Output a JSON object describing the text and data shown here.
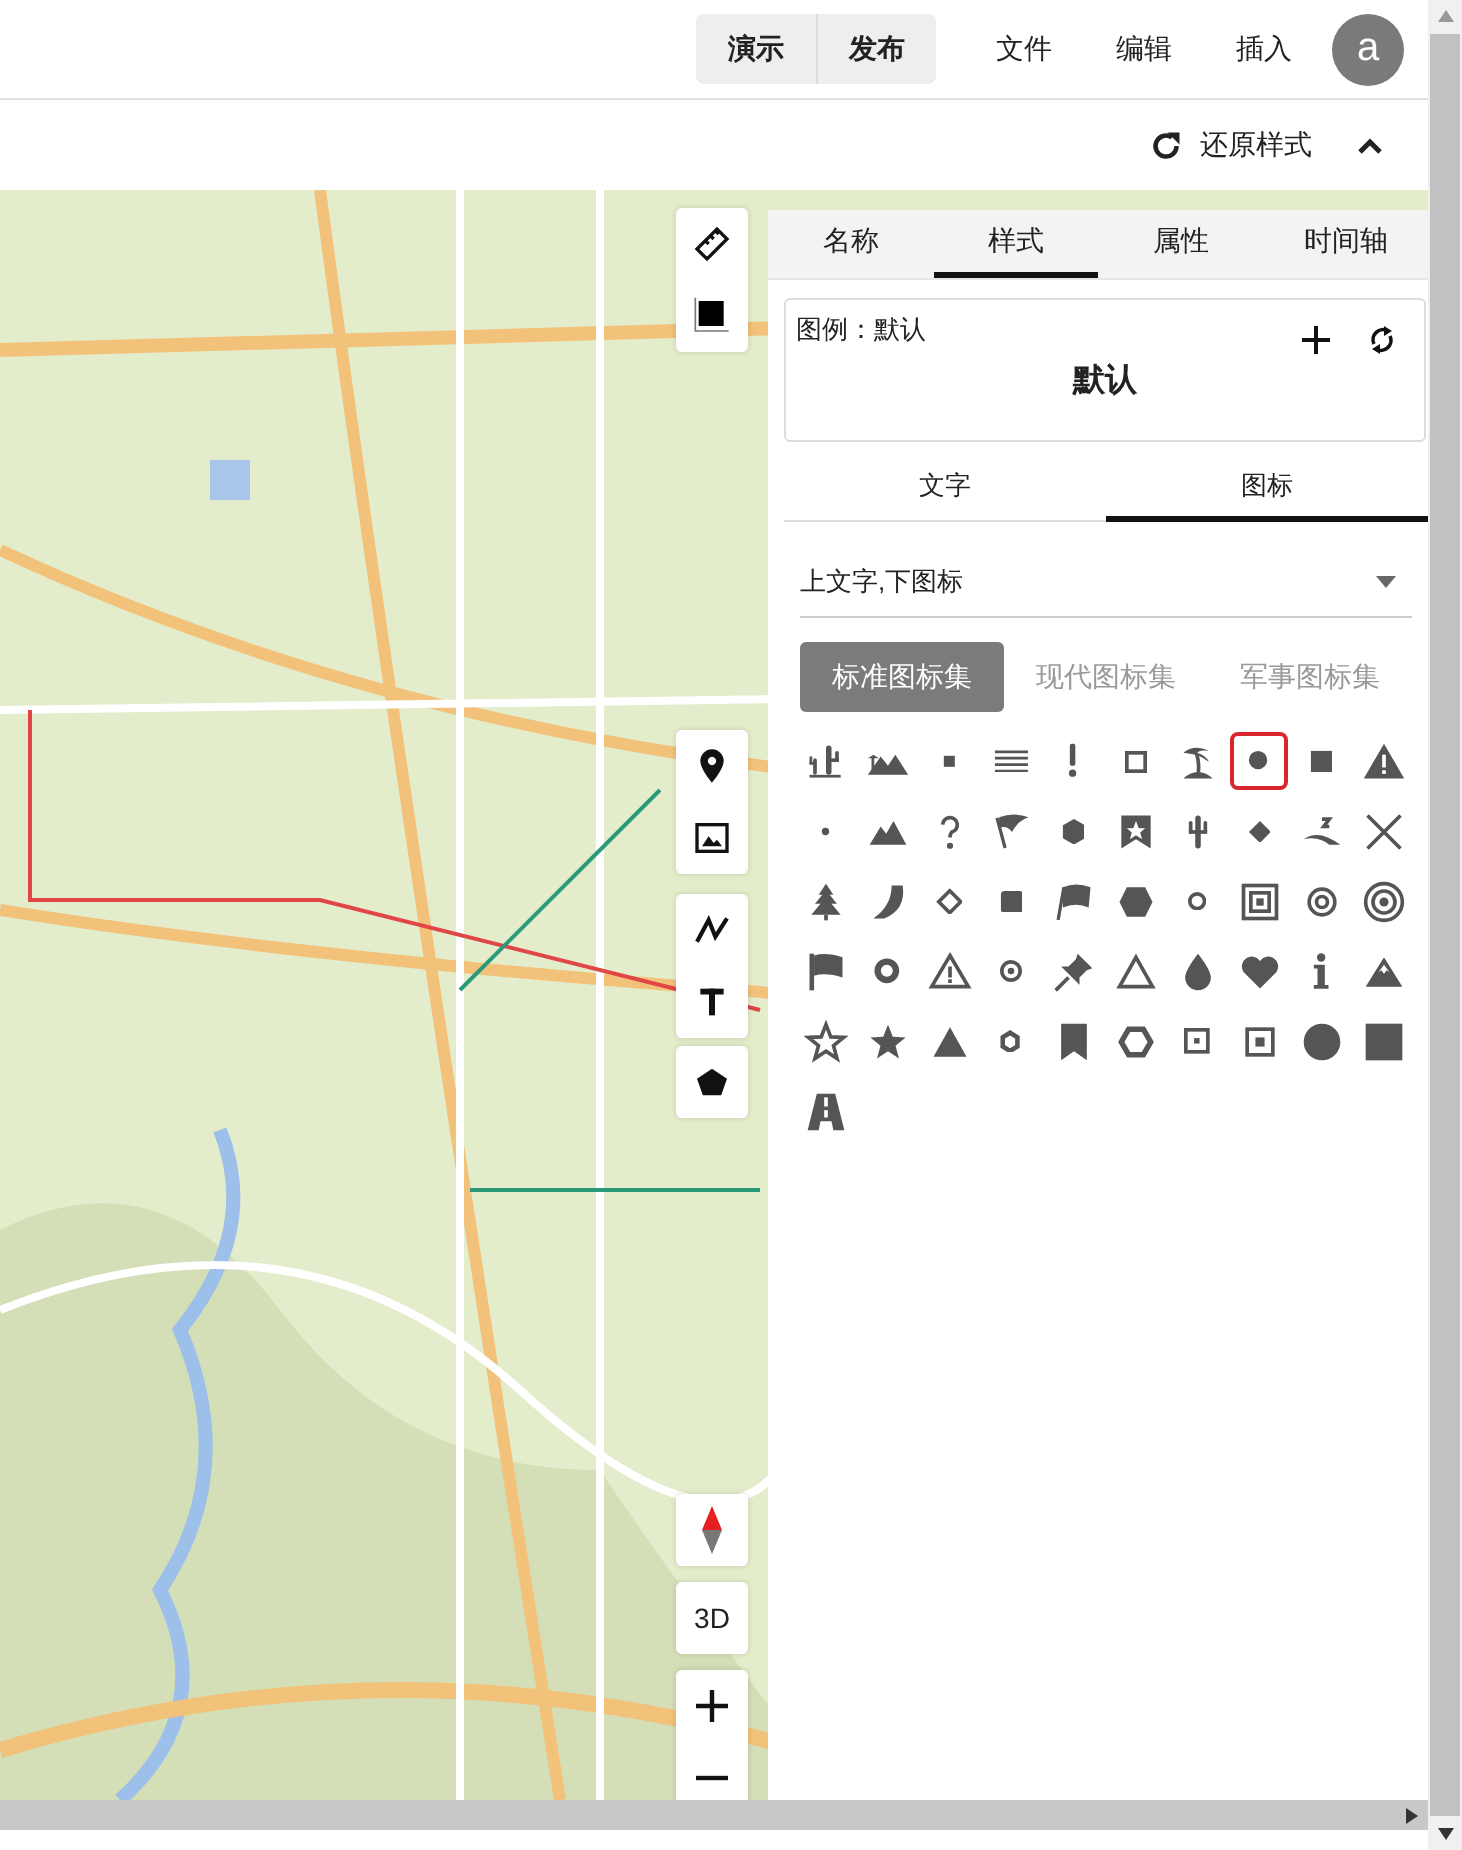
{
  "topbar": {
    "mode_buttons": [
      {
        "label": "演示"
      },
      {
        "label": "发布"
      }
    ],
    "menu": [
      {
        "label": "文件"
      },
      {
        "label": "编辑"
      },
      {
        "label": "插入"
      }
    ],
    "avatar": "a"
  },
  "subbar": {
    "reset_label": "还原样式"
  },
  "map": {
    "button_3d": "3D"
  },
  "panel": {
    "tabs": [
      {
        "label": "名称",
        "selected": false
      },
      {
        "label": "样式",
        "selected": true
      },
      {
        "label": "属性",
        "selected": false
      },
      {
        "label": "时间轴",
        "selected": false
      }
    ],
    "legend": {
      "label": "图例：默认",
      "name": "默认"
    },
    "subtabs": [
      {
        "label": "文字",
        "selected": false
      },
      {
        "label": "图标",
        "selected": true
      }
    ],
    "layout_select": {
      "value": "上文字,下图标"
    },
    "icon_sets": [
      {
        "label": "标准图标集",
        "selected": true
      },
      {
        "label": "现代图标集",
        "selected": false
      },
      {
        "label": "军事图标集",
        "selected": false
      }
    ],
    "icons": [
      {
        "selected": false
      },
      {
        "selected": false
      },
      {
        "selected": false
      },
      {
        "selected": false
      },
      {
        "selected": false
      },
      {
        "selected": false
      },
      {
        "selected": false
      },
      {
        "selected": true
      },
      {
        "selected": false
      },
      {
        "selected": false
      },
      {
        "selected": false
      },
      {
        "selected": false
      },
      {
        "selected": false
      },
      {
        "selected": false
      },
      {
        "selected": false
      },
      {
        "selected": false
      },
      {
        "selected": false
      },
      {
        "selected": false
      },
      {
        "selected": false
      },
      {
        "selected": false
      },
      {
        "selected": false
      },
      {
        "selected": false
      },
      {
        "selected": false
      },
      {
        "selected": false
      },
      {
        "selected": false
      },
      {
        "selected": false
      },
      {
        "selected": false
      },
      {
        "selected": false
      },
      {
        "selected": false
      },
      {
        "selected": false
      },
      {
        "selected": false
      },
      {
        "selected": false
      },
      {
        "selected": false
      },
      {
        "selected": false
      },
      {
        "selected": false
      },
      {
        "selected": false
      },
      {
        "selected": false
      },
      {
        "selected": false
      },
      {
        "selected": false
      },
      {
        "selected": false
      },
      {
        "selected": false
      },
      {
        "selected": false
      },
      {
        "selected": false
      },
      {
        "selected": false
      },
      {
        "selected": false
      },
      {
        "selected": false
      },
      {
        "selected": false
      },
      {
        "selected": false
      },
      {
        "selected": false
      },
      {
        "selected": false
      },
      {
        "selected": false
      }
    ]
  }
}
